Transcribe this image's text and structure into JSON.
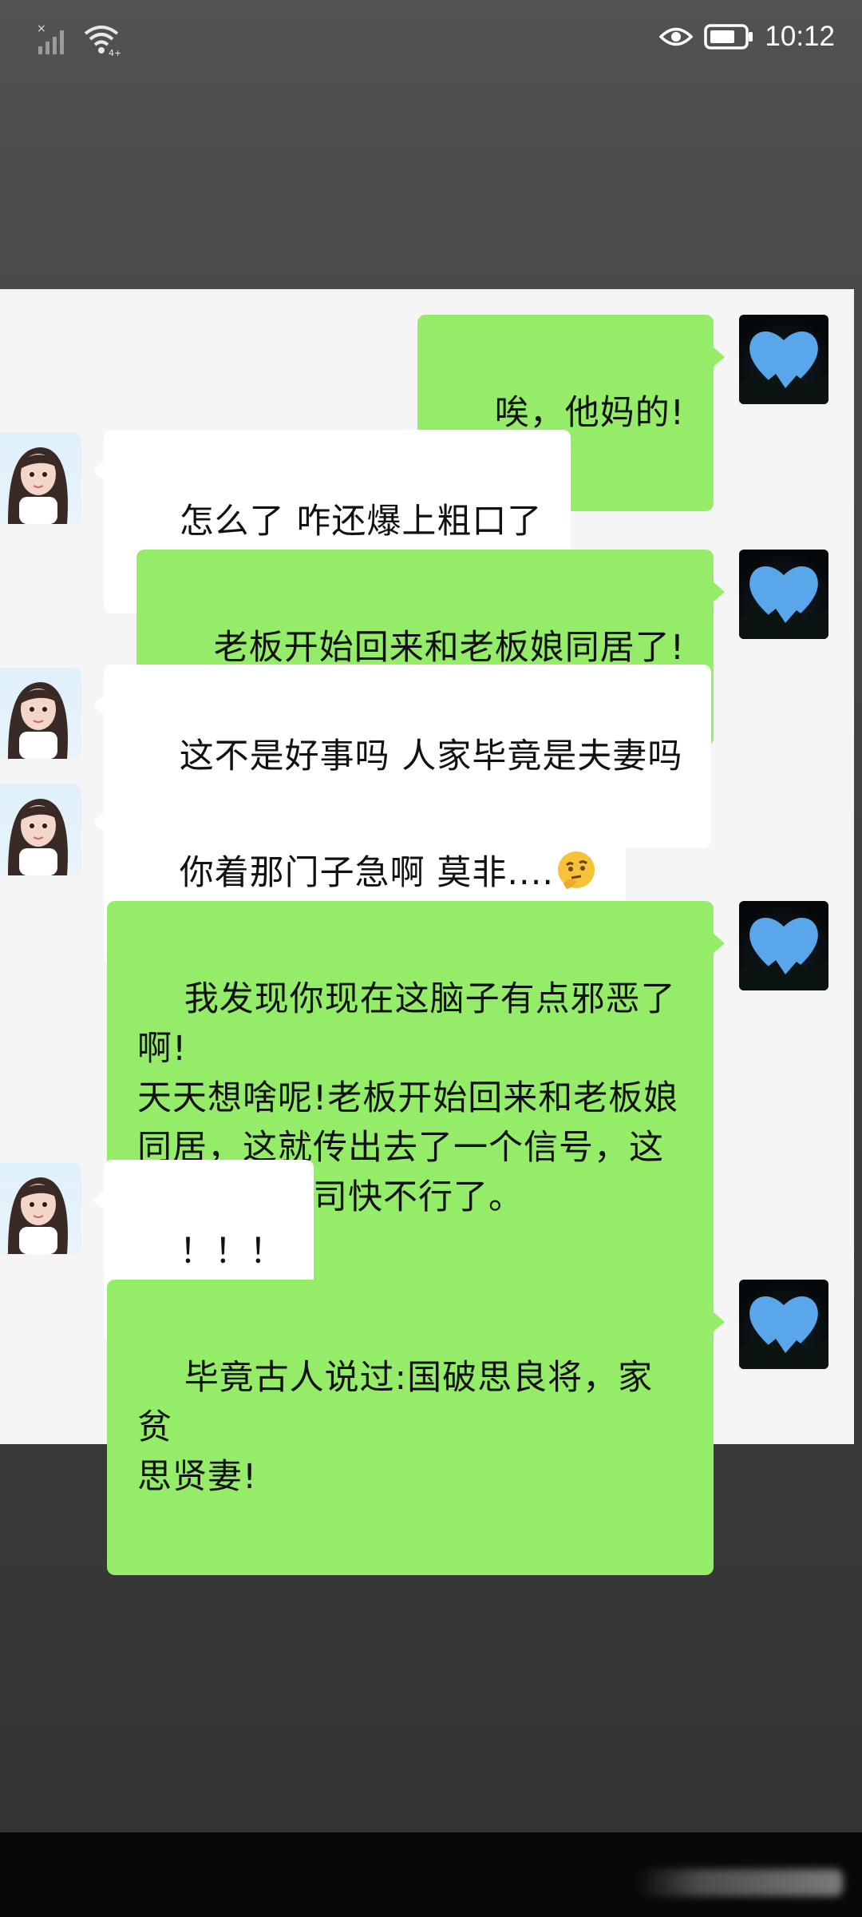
{
  "status_bar": {
    "time": "10:12",
    "icons": [
      "signal-icon",
      "wifi-icon",
      "eye-icon",
      "battery-icon"
    ]
  },
  "chat": {
    "messages": [
      {
        "from": "me",
        "text": "唉，他妈的!"
      },
      {
        "from": "her",
        "text": "怎么了 咋还爆上粗口了"
      },
      {
        "from": "me",
        "text": "老板开始回来和老板娘同居了!"
      },
      {
        "from": "her",
        "text": "这不是好事吗 人家毕竟是夫妻吗"
      },
      {
        "from": "her",
        "text": "你着那门子急啊 莫非....",
        "emoji": "thinking-face-emoji"
      },
      {
        "from": "me",
        "text": "我发现你现在这脑子有点邪恶了啊!\n天天想啥呢!老板开始回来和老板娘\n同居，这就传出去了一个信号，这\n十有八九公司快不行了。"
      },
      {
        "from": "her",
        "text": "！！！"
      },
      {
        "from": "me",
        "text": "毕竟古人说过:国破思良将，家贫\n思贤妻!"
      }
    ]
  },
  "colors": {
    "sent_bubble": "#95ec69",
    "recv_bubble": "#ffffff",
    "chat_background": "#f5f5f5"
  }
}
